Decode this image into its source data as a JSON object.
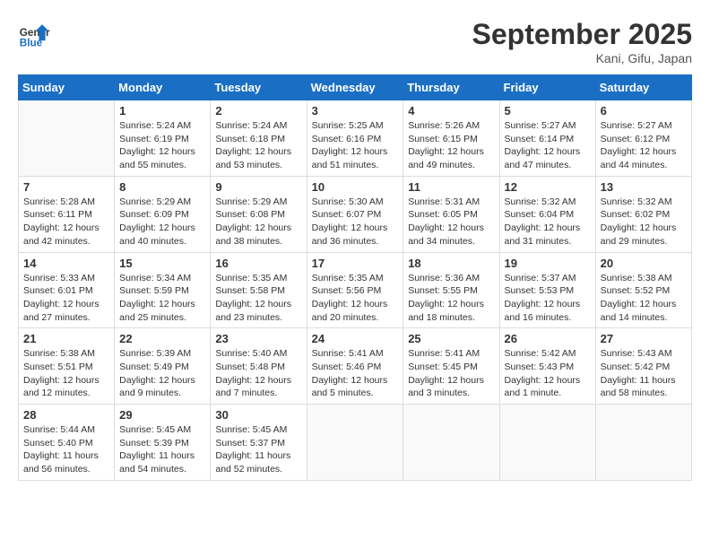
{
  "logo": {
    "line1": "General",
    "line2": "Blue"
  },
  "title": "September 2025",
  "subtitle": "Kani, Gifu, Japan",
  "weekdays": [
    "Sunday",
    "Monday",
    "Tuesday",
    "Wednesday",
    "Thursday",
    "Friday",
    "Saturday"
  ],
  "weeks": [
    [
      {
        "day": "",
        "info": ""
      },
      {
        "day": "1",
        "info": "Sunrise: 5:24 AM\nSunset: 6:19 PM\nDaylight: 12 hours\nand 55 minutes."
      },
      {
        "day": "2",
        "info": "Sunrise: 5:24 AM\nSunset: 6:18 PM\nDaylight: 12 hours\nand 53 minutes."
      },
      {
        "day": "3",
        "info": "Sunrise: 5:25 AM\nSunset: 6:16 PM\nDaylight: 12 hours\nand 51 minutes."
      },
      {
        "day": "4",
        "info": "Sunrise: 5:26 AM\nSunset: 6:15 PM\nDaylight: 12 hours\nand 49 minutes."
      },
      {
        "day": "5",
        "info": "Sunrise: 5:27 AM\nSunset: 6:14 PM\nDaylight: 12 hours\nand 47 minutes."
      },
      {
        "day": "6",
        "info": "Sunrise: 5:27 AM\nSunset: 6:12 PM\nDaylight: 12 hours\nand 44 minutes."
      }
    ],
    [
      {
        "day": "7",
        "info": "Sunrise: 5:28 AM\nSunset: 6:11 PM\nDaylight: 12 hours\nand 42 minutes."
      },
      {
        "day": "8",
        "info": "Sunrise: 5:29 AM\nSunset: 6:09 PM\nDaylight: 12 hours\nand 40 minutes."
      },
      {
        "day": "9",
        "info": "Sunrise: 5:29 AM\nSunset: 6:08 PM\nDaylight: 12 hours\nand 38 minutes."
      },
      {
        "day": "10",
        "info": "Sunrise: 5:30 AM\nSunset: 6:07 PM\nDaylight: 12 hours\nand 36 minutes."
      },
      {
        "day": "11",
        "info": "Sunrise: 5:31 AM\nSunset: 6:05 PM\nDaylight: 12 hours\nand 34 minutes."
      },
      {
        "day": "12",
        "info": "Sunrise: 5:32 AM\nSunset: 6:04 PM\nDaylight: 12 hours\nand 31 minutes."
      },
      {
        "day": "13",
        "info": "Sunrise: 5:32 AM\nSunset: 6:02 PM\nDaylight: 12 hours\nand 29 minutes."
      }
    ],
    [
      {
        "day": "14",
        "info": "Sunrise: 5:33 AM\nSunset: 6:01 PM\nDaylight: 12 hours\nand 27 minutes."
      },
      {
        "day": "15",
        "info": "Sunrise: 5:34 AM\nSunset: 5:59 PM\nDaylight: 12 hours\nand 25 minutes."
      },
      {
        "day": "16",
        "info": "Sunrise: 5:35 AM\nSunset: 5:58 PM\nDaylight: 12 hours\nand 23 minutes."
      },
      {
        "day": "17",
        "info": "Sunrise: 5:35 AM\nSunset: 5:56 PM\nDaylight: 12 hours\nand 20 minutes."
      },
      {
        "day": "18",
        "info": "Sunrise: 5:36 AM\nSunset: 5:55 PM\nDaylight: 12 hours\nand 18 minutes."
      },
      {
        "day": "19",
        "info": "Sunrise: 5:37 AM\nSunset: 5:53 PM\nDaylight: 12 hours\nand 16 minutes."
      },
      {
        "day": "20",
        "info": "Sunrise: 5:38 AM\nSunset: 5:52 PM\nDaylight: 12 hours\nand 14 minutes."
      }
    ],
    [
      {
        "day": "21",
        "info": "Sunrise: 5:38 AM\nSunset: 5:51 PM\nDaylight: 12 hours\nand 12 minutes."
      },
      {
        "day": "22",
        "info": "Sunrise: 5:39 AM\nSunset: 5:49 PM\nDaylight: 12 hours\nand 9 minutes."
      },
      {
        "day": "23",
        "info": "Sunrise: 5:40 AM\nSunset: 5:48 PM\nDaylight: 12 hours\nand 7 minutes."
      },
      {
        "day": "24",
        "info": "Sunrise: 5:41 AM\nSunset: 5:46 PM\nDaylight: 12 hours\nand 5 minutes."
      },
      {
        "day": "25",
        "info": "Sunrise: 5:41 AM\nSunset: 5:45 PM\nDaylight: 12 hours\nand 3 minutes."
      },
      {
        "day": "26",
        "info": "Sunrise: 5:42 AM\nSunset: 5:43 PM\nDaylight: 12 hours\nand 1 minute."
      },
      {
        "day": "27",
        "info": "Sunrise: 5:43 AM\nSunset: 5:42 PM\nDaylight: 11 hours\nand 58 minutes."
      }
    ],
    [
      {
        "day": "28",
        "info": "Sunrise: 5:44 AM\nSunset: 5:40 PM\nDaylight: 11 hours\nand 56 minutes."
      },
      {
        "day": "29",
        "info": "Sunrise: 5:45 AM\nSunset: 5:39 PM\nDaylight: 11 hours\nand 54 minutes."
      },
      {
        "day": "30",
        "info": "Sunrise: 5:45 AM\nSunset: 5:37 PM\nDaylight: 11 hours\nand 52 minutes."
      },
      {
        "day": "",
        "info": ""
      },
      {
        "day": "",
        "info": ""
      },
      {
        "day": "",
        "info": ""
      },
      {
        "day": "",
        "info": ""
      }
    ]
  ]
}
